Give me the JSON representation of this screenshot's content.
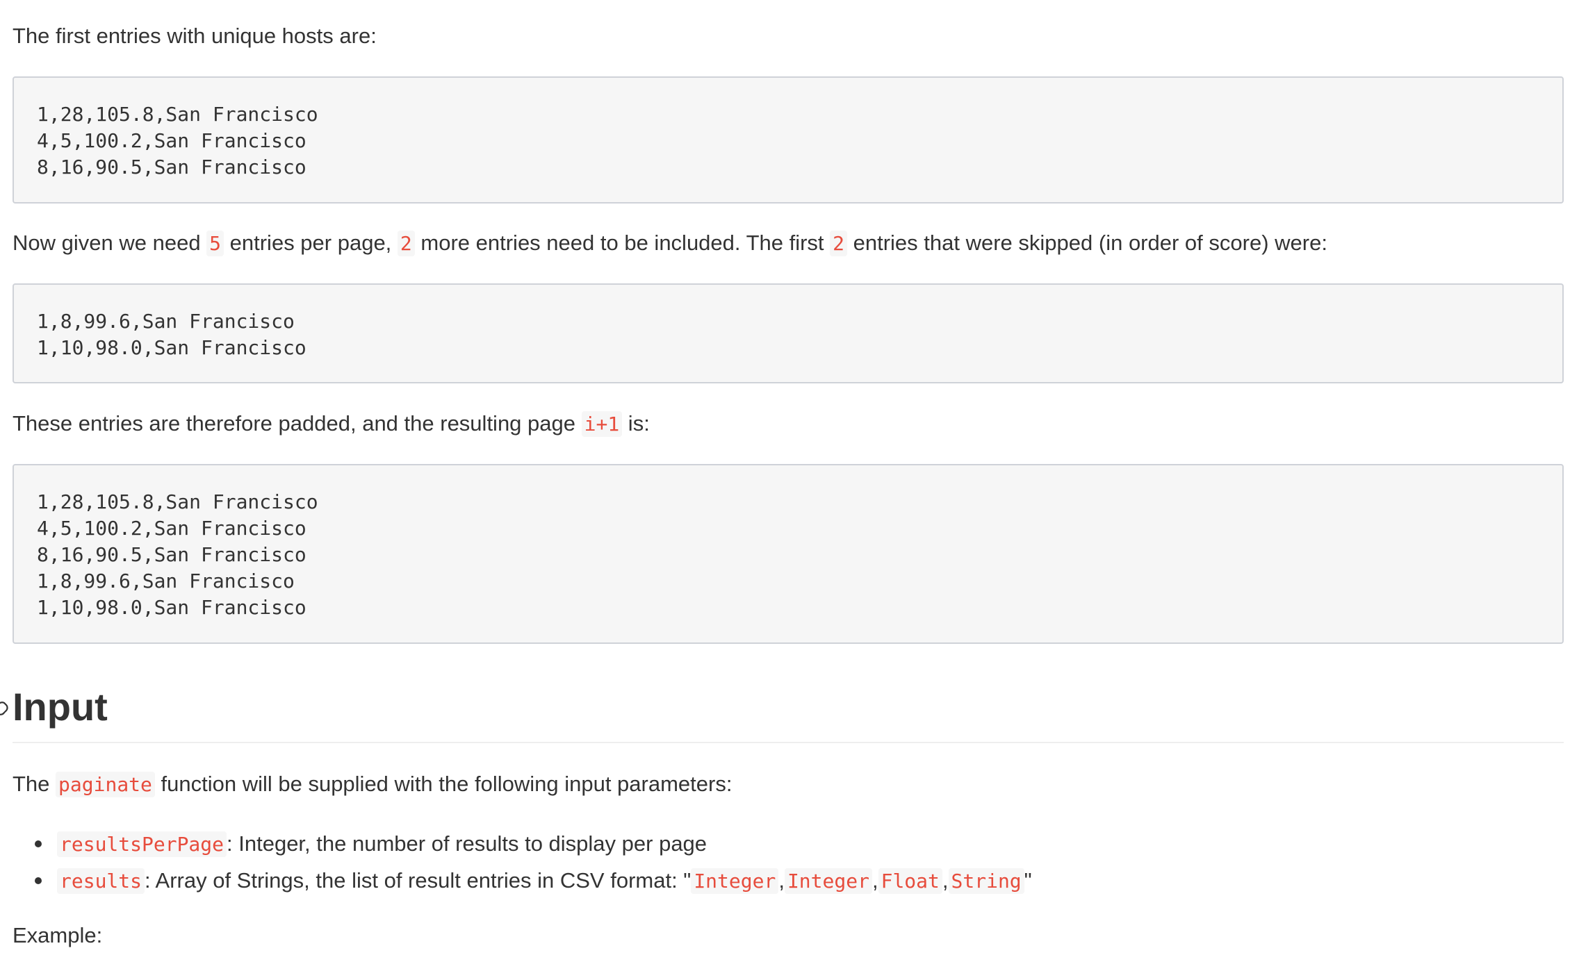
{
  "paragraphs": {
    "p1": "The first entries with unique hosts are:",
    "p2": {
      "a": "Now given we need ",
      "code1": "5",
      "b": " entries per page, ",
      "code2": "2",
      "c": " more entries need to be included. The first ",
      "code3": "2",
      "d": " entries that were skipped (in order of score) were:"
    },
    "p3": {
      "a": "These entries are therefore padded, and the resulting page ",
      "code": "i+1",
      "b": " is:"
    },
    "p4": {
      "a": "The ",
      "code": "paginate",
      "b": " function will be supplied with the following input parameters:"
    },
    "p5": "Example:"
  },
  "code_blocks": [
    [
      "1,28,105.8,San Francisco",
      "4,5,100.2,San Francisco",
      "8,16,90.5,San Francisco"
    ],
    [
      "1,8,99.6,San Francisco",
      "1,10,98.0,San Francisco"
    ],
    [
      "1,28,105.8,San Francisco",
      "4,5,100.2,San Francisco",
      "8,16,90.5,San Francisco",
      "1,8,99.6,San Francisco",
      "1,10,98.0,San Francisco"
    ]
  ],
  "heading": "Input",
  "params": [
    {
      "code": "resultsPerPage",
      "text": ": Integer, the number of results to display per page"
    },
    {
      "code": "results",
      "text": ": Array of Strings, the list of result entries in CSV format: \"",
      "types": [
        "Integer",
        "Integer",
        "Float",
        "String"
      ],
      "sep": ",",
      "close": "\""
    }
  ],
  "colors": {
    "text": "#333333",
    "inline_code": "#e74c3c",
    "code_bg": "#f6f6f6",
    "code_border": "#cfd2d8"
  },
  "icons": {
    "heading_anchor": "link-icon"
  }
}
